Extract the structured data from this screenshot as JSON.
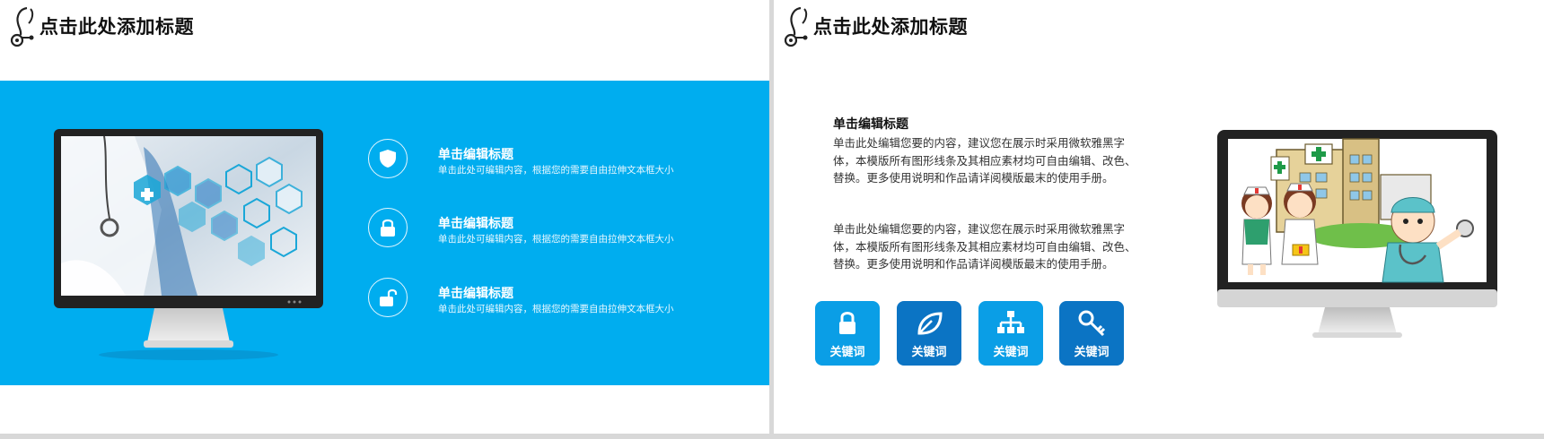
{
  "colors": {
    "accent_blue": "#00adef",
    "dark_blue": "#0b74c4",
    "mid_blue": "#0a9ee6"
  },
  "left_slide": {
    "title": "点击此处添加标题",
    "header_icon": "stethoscope-icon",
    "features": [
      {
        "icon": "shield-icon",
        "title": "单击编辑标题",
        "desc": "单击此处可编辑内容，根据您的需要自由拉伸文本框大小"
      },
      {
        "icon": "lock-icon",
        "title": "单击编辑标题",
        "desc": "单击此处可编辑内容，根据您的需要自由拉伸文本框大小"
      },
      {
        "icon": "unlock-icon",
        "title": "单击编辑标题",
        "desc": "单击此处可编辑内容，根据您的需要自由拉伸文本框大小"
      }
    ]
  },
  "right_slide": {
    "title": "点击此处添加标题",
    "header_icon": "stethoscope-icon",
    "text_title": "单击编辑标题",
    "paragraphs": [
      "单击此处编辑您要的内容，建议您在展示时采用微软雅黑字体，本模版所有图形线条及其相应素材均可自由编辑、改色、替换。更多使用说明和作品请详阅模版最末的使用手册。",
      "单击此处编辑您要的内容，建议您在展示时采用微软雅黑字体，本模版所有图形线条及其相应素材均可自由编辑、改色、替换。更多使用说明和作品请详阅模版最末的使用手册。"
    ],
    "keywords": [
      {
        "icon": "lock-icon",
        "label": "关键词",
        "color": "#0a9ee6"
      },
      {
        "icon": "leaf-icon",
        "label": "关键词",
        "color": "#0b74c4"
      },
      {
        "icon": "org-chart-icon",
        "label": "关键词",
        "color": "#0a9ee6"
      },
      {
        "icon": "key-icon",
        "label": "关键词",
        "color": "#0b74c4"
      }
    ]
  }
}
